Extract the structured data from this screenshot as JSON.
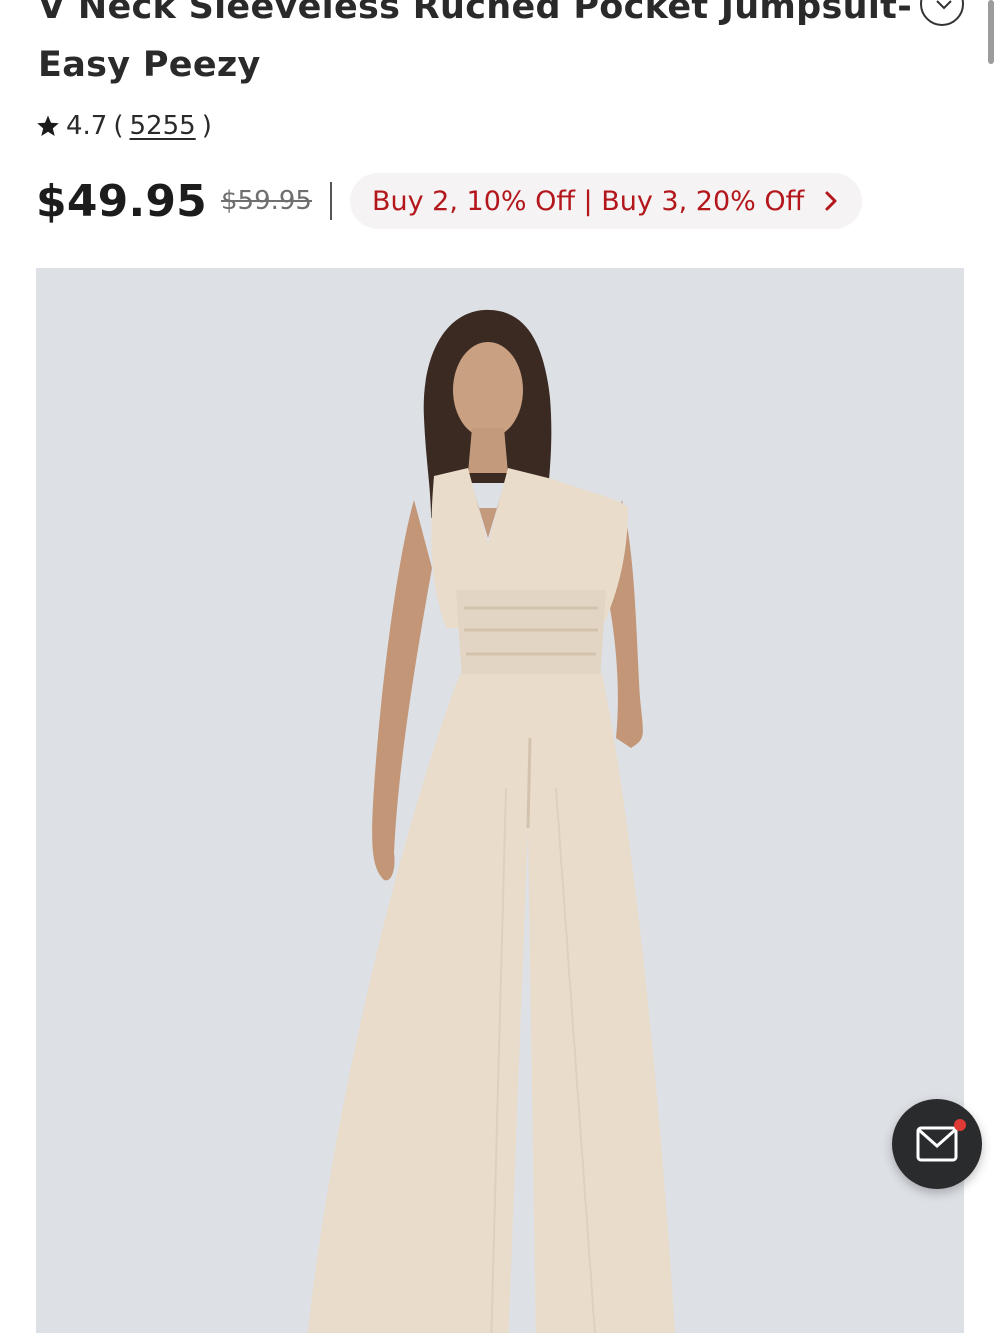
{
  "product": {
    "title_line1": "V Neck Sleeveless Ruched Pocket Jumpsuit-",
    "title_line2": "Easy Peezy",
    "rating": "4.7",
    "open_paren": "(",
    "review_count": "5255",
    "close_paren": ")",
    "price": "$49.95",
    "original_price": "$59.95",
    "promo": "Buy 2, 10% Off | Buy 3, 20% Off",
    "image_alt": "Model wearing beige sleeveless V neck wide-leg jumpsuit"
  },
  "icons": {
    "collapse": "chevron-down-circle-icon",
    "rating": "star-icon",
    "promo": "chevron-right-icon",
    "fab": "mail-icon"
  },
  "colors": {
    "promo_text": "#b3161b",
    "promo_bg": "#f5f3f3",
    "image_bg": "#dde0e5",
    "garment": "#e9dccb",
    "fab_bg": "#2a2b2d",
    "notification_dot": "#e03a36"
  }
}
